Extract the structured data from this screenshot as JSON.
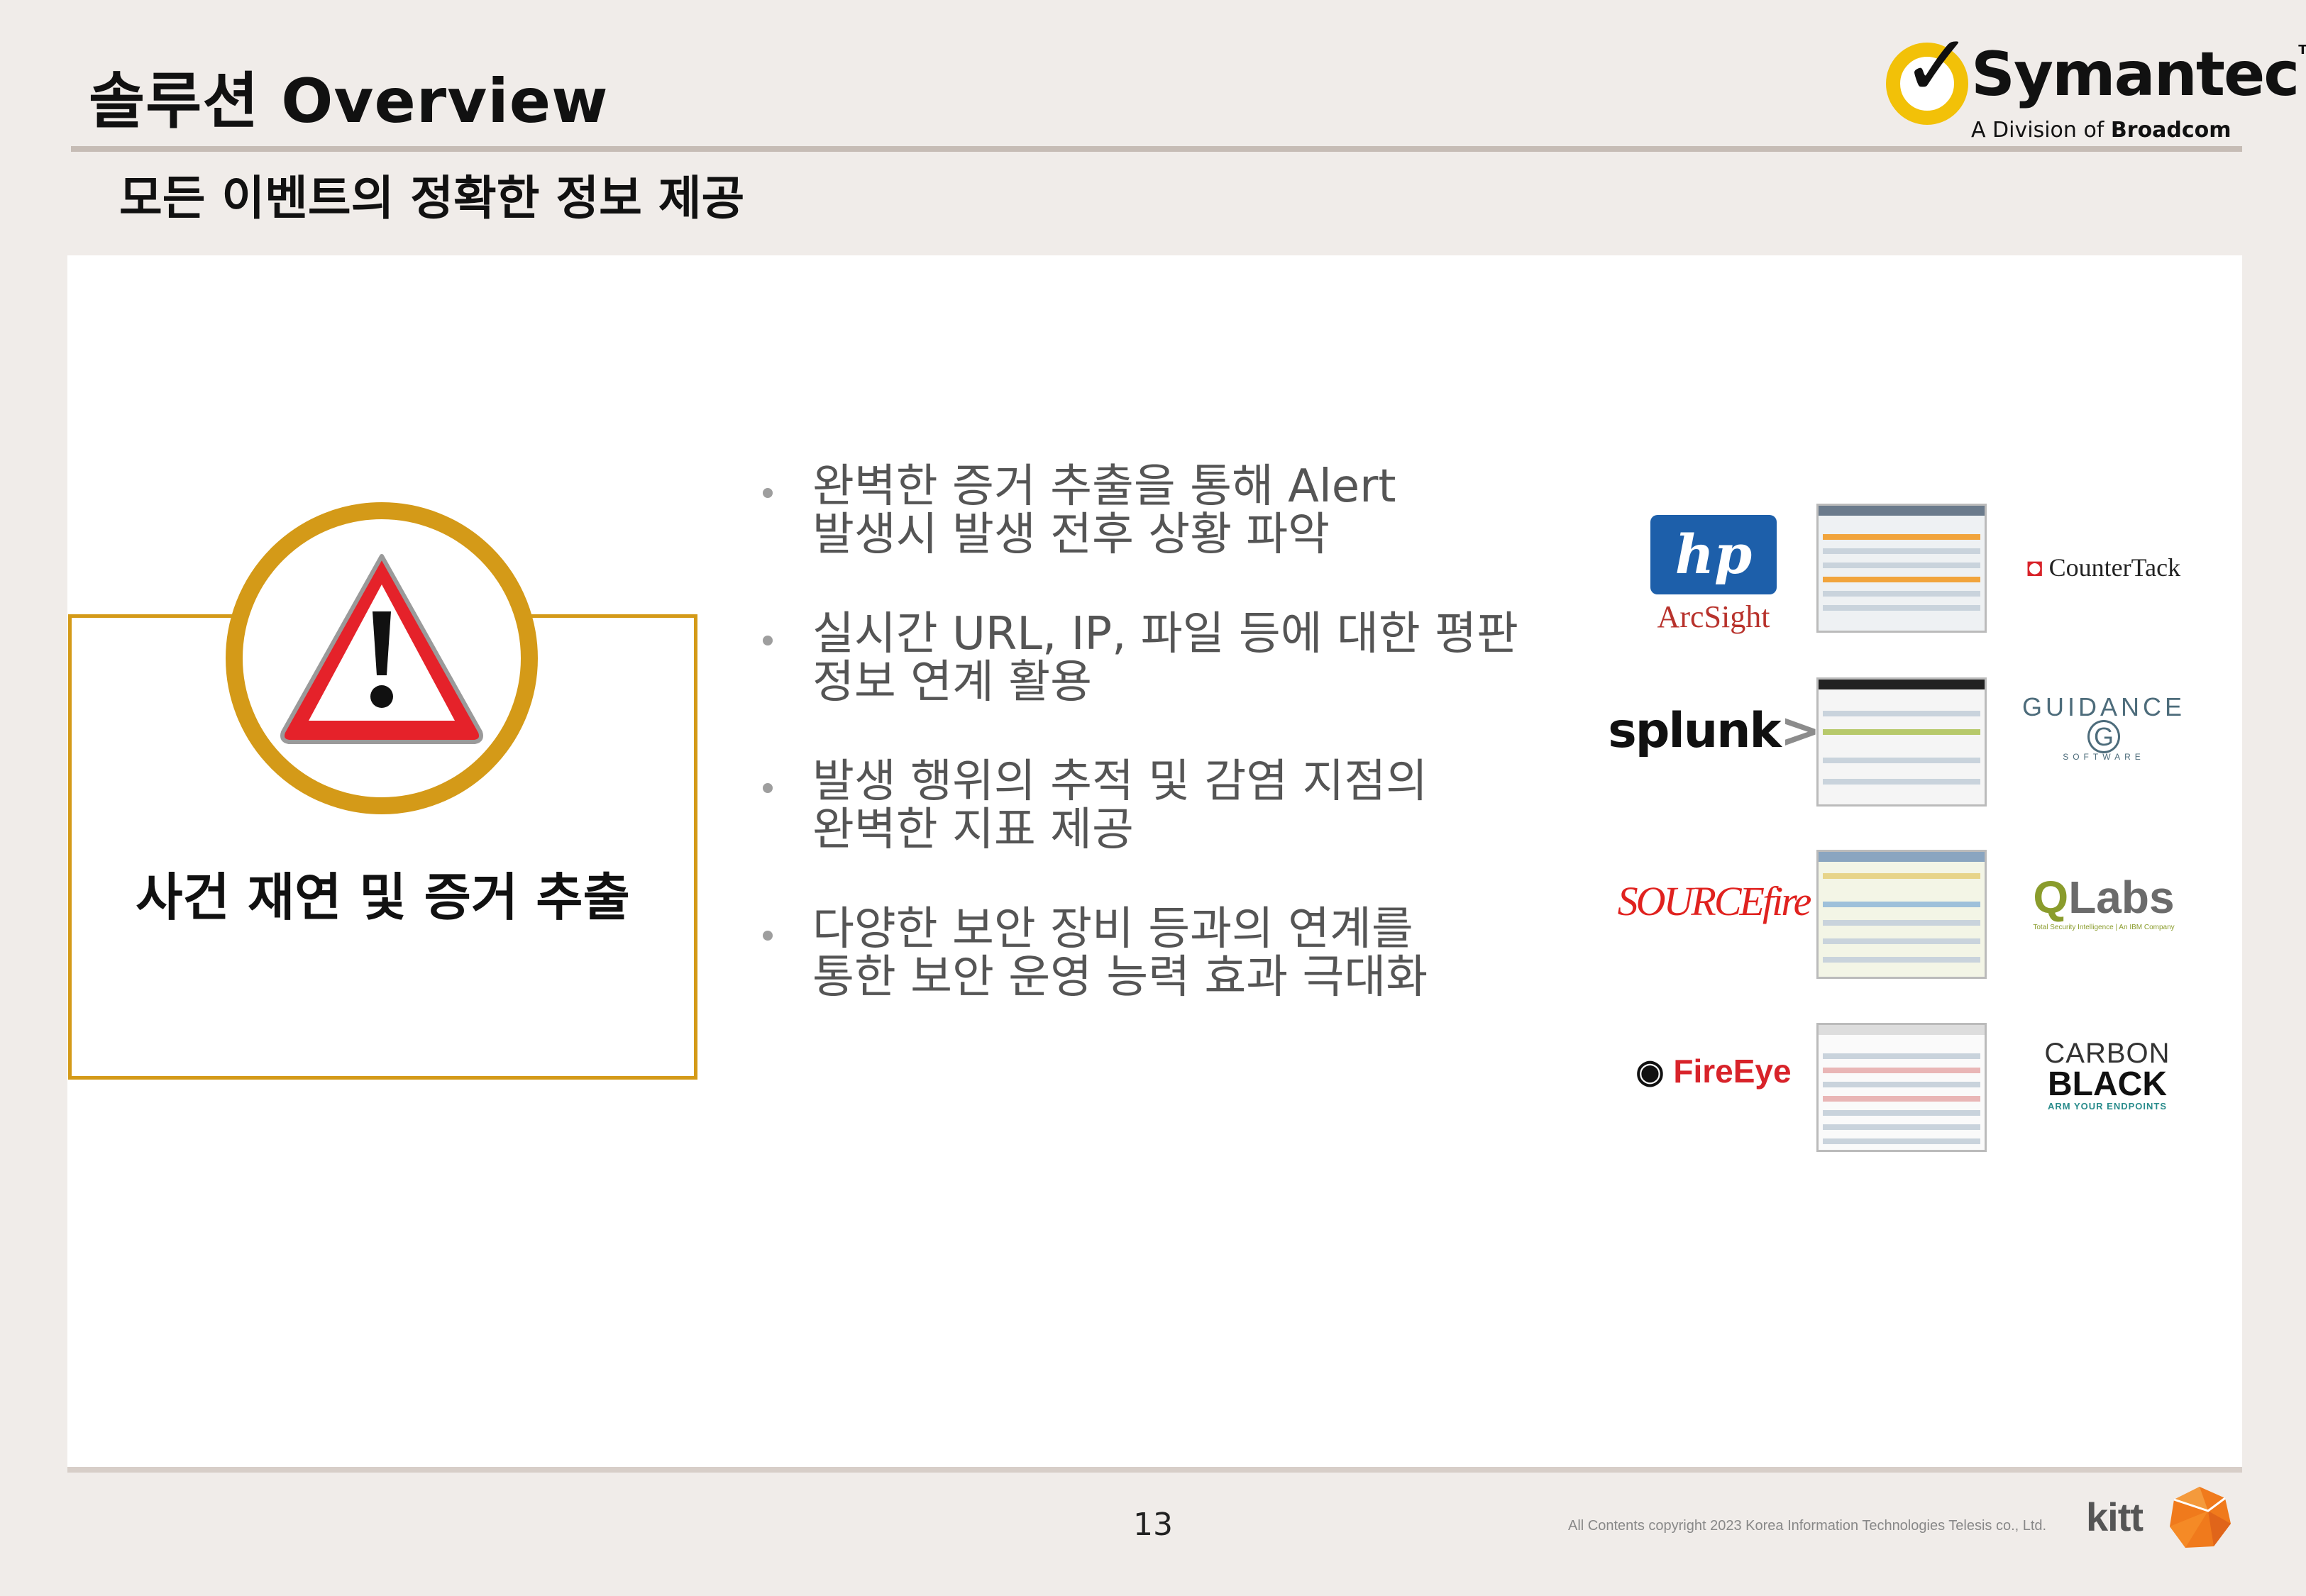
{
  "header": {
    "title": "솔루션 Overview",
    "subtitle": "모든 이벤트의 정확한 정보 제공"
  },
  "logo": {
    "brand": "Symantec",
    "tm": "TM",
    "division_prefix": "A Division of ",
    "division_name": "Broadcom",
    "icon": "checkmark-logo-icon",
    "accent": "#f2c108"
  },
  "feature_box": {
    "label": "사건 재연 및 증거 추출",
    "icon": "warning-triangle-icon",
    "border_color": "#d49a18"
  },
  "bullets": [
    {
      "text": "완벽한 증거 추출을 통해 Alert\n발생시 발생 전후 상황 파악"
    },
    {
      "text": "실시간 URL, IP, 파일 등에 대한 평판\n정보 연계 활용"
    },
    {
      "text": "발생 행위의 추적 및 감염 지점의\n완벽한 지표 제공"
    },
    {
      "text": "다양한 보안 장비 등과의 연계를\n통한 보안 운영 능력 효과 극대화"
    }
  ],
  "partners": {
    "hp": "hp",
    "arcsight": "ArcSight",
    "counter": "CounterTack",
    "splunk": "splunk",
    "splunk_mark": ">",
    "guidance": "GUIDANCE",
    "guidance_sub": "SOFTWARE",
    "guidance_mark": "G",
    "source": "SOURCE",
    "source_fire": "fire",
    "qlabs_q": "Q",
    "qlabs": "Labs",
    "qlabs_sub": "Total Security Intelligence | An IBM Company",
    "fireeye": "FireEye",
    "carbon_1": "CARBON",
    "carbon_2": "BLACK",
    "carbon_3": "ARM YOUR ENDPOINTS"
  },
  "footer": {
    "page_number": "13",
    "copyright": "All Contents copyright 2023 Korea Information Technologies Telesis co., Ltd.",
    "kitt": "kitt"
  }
}
